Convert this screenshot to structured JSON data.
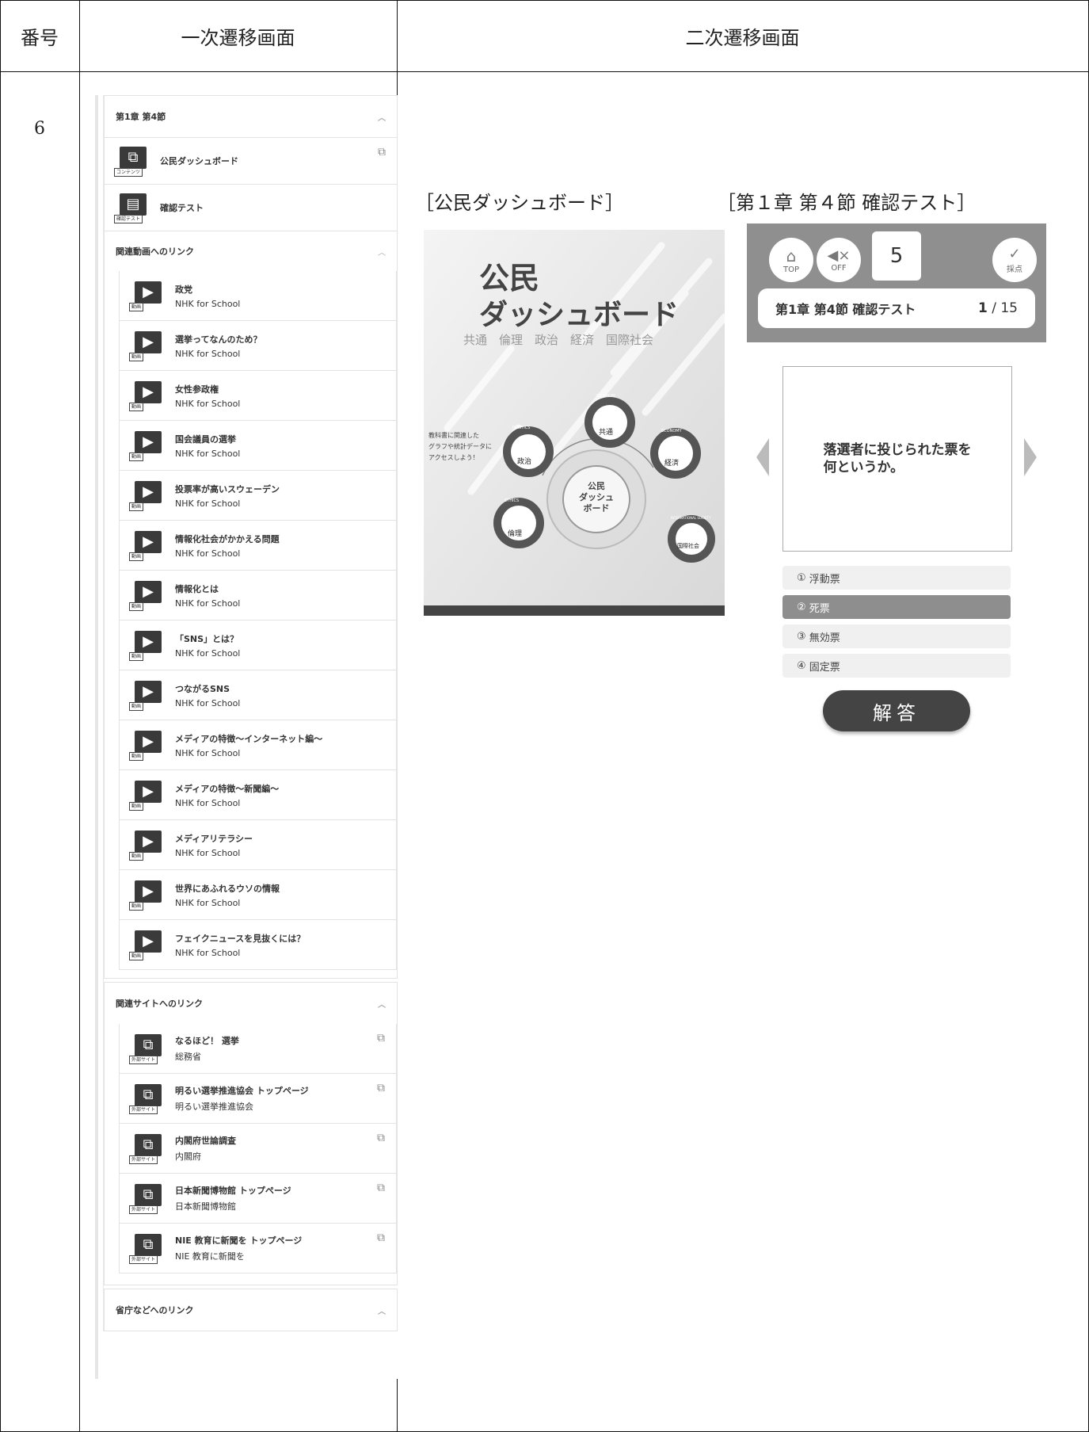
{
  "table": {
    "headers": [
      "番号",
      "一次遷移画面",
      "二次遷移画面"
    ],
    "row_number": "6"
  },
  "left_panel": {
    "chapter_section": {
      "title": "第1章 第4節",
      "items": [
        {
          "title": "公民ダッシュボード",
          "tag": "コンテンツ",
          "icon": "external-link-icon"
        },
        {
          "title": "確認テスト",
          "tag": "確認テスト",
          "icon": "test-icon"
        }
      ]
    },
    "videos": {
      "title": "関連動画へのリンク",
      "tag": "動画",
      "items": [
        {
          "title": "政党",
          "source": "NHK for School"
        },
        {
          "title": "選挙ってなんのため？",
          "source": "NHK for School"
        },
        {
          "title": "女性参政権",
          "source": "NHK for School"
        },
        {
          "title": "国会議員の選挙",
          "source": "NHK for School"
        },
        {
          "title": "投票率が高いスウェーデン",
          "source": "NHK for School"
        },
        {
          "title": "情報化社会がかかえる問題",
          "source": "NHK for School"
        },
        {
          "title": "情報化とは",
          "source": "NHK for School"
        },
        {
          "title": "「SNS」とは？",
          "source": "NHK for School"
        },
        {
          "title": "つながるSNS",
          "source": "NHK for School"
        },
        {
          "title": "メディアの特徴～インターネット編～",
          "source": "NHK for School"
        },
        {
          "title": "メディアの特徴～新聞編～",
          "source": "NHK for School"
        },
        {
          "title": "メディアリテラシー",
          "source": "NHK for School"
        },
        {
          "title": "世界にあふれるウソの情報",
          "source": "NHK for School"
        },
        {
          "title": "フェイクニュースを見抜くには？",
          "source": "NHK for School"
        }
      ]
    },
    "sites": {
      "title": "関連サイトへのリンク",
      "tag": "外部サイト",
      "items": [
        {
          "title": "なるほど！ 選挙",
          "source": "総務省"
        },
        {
          "title": "明るい選挙推進協会 トップページ",
          "source": "明るい選挙推進協会"
        },
        {
          "title": "内閣府世論調査",
          "source": "内閣府"
        },
        {
          "title": "日本新聞博物館 トップページ",
          "source": "日本新聞博物館"
        },
        {
          "title": "NIE 教育に新聞を トップページ",
          "source": "NIE 教育に新聞を"
        }
      ]
    },
    "ministries": {
      "title": "省庁などへのリンク"
    }
  },
  "dashboard": {
    "caption": "［公民ダッシュボード］",
    "title_line1": "公民",
    "title_line2": "ダッシュボード",
    "subjects_line": "共通　倫理　政治　経済　国際社会",
    "side_text": [
      "教科書に関連した",
      "グラフや統計データに",
      "アクセスしよう！"
    ],
    "hub": [
      "公民",
      "ダッシュ",
      "ボード"
    ],
    "nodes": {
      "common": "共通",
      "politics": "政治",
      "economy": "経済",
      "ethics": "倫理",
      "international": "国際社会"
    },
    "arc_labels": {
      "common": "COMMON",
      "politics": "POLITICS",
      "economy": "ECONOMY",
      "ethics": "ETHICS",
      "international": "INTERNATIONAL SOCIETY"
    }
  },
  "quiz": {
    "caption": "［第１章 第４節 確認テスト］",
    "home_label": "TOP",
    "sound_label": "OFF",
    "counter": "5",
    "score_label": "採点",
    "test_title": "第1章 第4節 確認テスト",
    "progress_current": "1",
    "progress_total": "/ 15",
    "question_line1": "落選者に投じられた票を",
    "question_line2": "何というか。",
    "choices": [
      {
        "num": "①",
        "text": "浮動票"
      },
      {
        "num": "②",
        "text": "死票",
        "selected": true
      },
      {
        "num": "③",
        "text": "無効票"
      },
      {
        "num": "④",
        "text": "固定票"
      }
    ],
    "answer_label": "解答"
  }
}
